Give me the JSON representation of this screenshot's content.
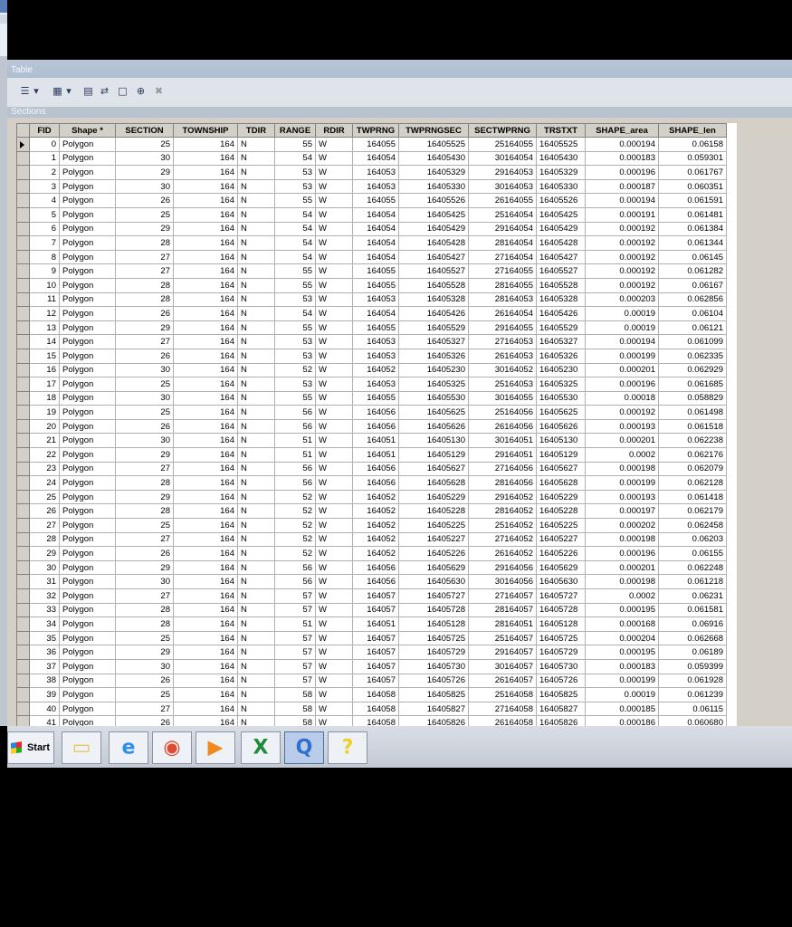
{
  "window": {
    "title": "Table",
    "tab_caption": "Sections"
  },
  "toolbar": {
    "icons": [
      "table-options-icon",
      "related-tables-icon",
      "select-by-attributes-icon",
      "switch-selection-icon",
      "clear-selection-icon",
      "zoom-to-selected-icon",
      "delete-selected-icon"
    ]
  },
  "table": {
    "columns": [
      "FID",
      "Shape *",
      "SECTION",
      "TOWNSHIP",
      "TDIR",
      "RANGE",
      "RDIR",
      "TWPRNG",
      "TWPRNGSEC",
      "SECTWPRNG",
      "TRSTXT",
      "SHAPE_area",
      "SHAPE_len"
    ],
    "rows": [
      [
        "0",
        "Polygon",
        "25",
        "164",
        "N",
        "55",
        "W",
        "164055",
        "16405525",
        "25164055",
        "16405525",
        "0.000194",
        "0.06158"
      ],
      [
        "1",
        "Polygon",
        "30",
        "164",
        "N",
        "54",
        "W",
        "164054",
        "16405430",
        "30164054",
        "16405430",
        "0.000183",
        "0.059301"
      ],
      [
        "2",
        "Polygon",
        "29",
        "164",
        "N",
        "53",
        "W",
        "164053",
        "16405329",
        "29164053",
        "16405329",
        "0.000196",
        "0.061767"
      ],
      [
        "3",
        "Polygon",
        "30",
        "164",
        "N",
        "53",
        "W",
        "164053",
        "16405330",
        "30164053",
        "16405330",
        "0.000187",
        "0.060351"
      ],
      [
        "4",
        "Polygon",
        "26",
        "164",
        "N",
        "55",
        "W",
        "164055",
        "16405526",
        "26164055",
        "16405526",
        "0.000194",
        "0.061591"
      ],
      [
        "5",
        "Polygon",
        "25",
        "164",
        "N",
        "54",
        "W",
        "164054",
        "16405425",
        "25164054",
        "16405425",
        "0.000191",
        "0.061481"
      ],
      [
        "6",
        "Polygon",
        "29",
        "164",
        "N",
        "54",
        "W",
        "164054",
        "16405429",
        "29164054",
        "16405429",
        "0.000192",
        "0.061384"
      ],
      [
        "7",
        "Polygon",
        "28",
        "164",
        "N",
        "54",
        "W",
        "164054",
        "16405428",
        "28164054",
        "16405428",
        "0.000192",
        "0.061344"
      ],
      [
        "8",
        "Polygon",
        "27",
        "164",
        "N",
        "54",
        "W",
        "164054",
        "16405427",
        "27164054",
        "16405427",
        "0.000192",
        "0.06145"
      ],
      [
        "9",
        "Polygon",
        "27",
        "164",
        "N",
        "55",
        "W",
        "164055",
        "16405527",
        "27164055",
        "16405527",
        "0.000192",
        "0.061282"
      ],
      [
        "10",
        "Polygon",
        "28",
        "164",
        "N",
        "55",
        "W",
        "164055",
        "16405528",
        "28164055",
        "16405528",
        "0.000192",
        "0.06167"
      ],
      [
        "11",
        "Polygon",
        "28",
        "164",
        "N",
        "53",
        "W",
        "164053",
        "16405328",
        "28164053",
        "16405328",
        "0.000203",
        "0.062856"
      ],
      [
        "12",
        "Polygon",
        "26",
        "164",
        "N",
        "54",
        "W",
        "164054",
        "16405426",
        "26164054",
        "16405426",
        "0.00019",
        "0.06104"
      ],
      [
        "13",
        "Polygon",
        "29",
        "164",
        "N",
        "55",
        "W",
        "164055",
        "16405529",
        "29164055",
        "16405529",
        "0.00019",
        "0.06121"
      ],
      [
        "14",
        "Polygon",
        "27",
        "164",
        "N",
        "53",
        "W",
        "164053",
        "16405327",
        "27164053",
        "16405327",
        "0.000194",
        "0.061099"
      ],
      [
        "15",
        "Polygon",
        "26",
        "164",
        "N",
        "53",
        "W",
        "164053",
        "16405326",
        "26164053",
        "16405326",
        "0.000199",
        "0.062335"
      ],
      [
        "16",
        "Polygon",
        "30",
        "164",
        "N",
        "52",
        "W",
        "164052",
        "16405230",
        "30164052",
        "16405230",
        "0.000201",
        "0.062929"
      ],
      [
        "17",
        "Polygon",
        "25",
        "164",
        "N",
        "53",
        "W",
        "164053",
        "16405325",
        "25164053",
        "16405325",
        "0.000196",
        "0.061685"
      ],
      [
        "18",
        "Polygon",
        "30",
        "164",
        "N",
        "55",
        "W",
        "164055",
        "16405530",
        "30164055",
        "16405530",
        "0.00018",
        "0.058829"
      ],
      [
        "19",
        "Polygon",
        "25",
        "164",
        "N",
        "56",
        "W",
        "164056",
        "16405625",
        "25164056",
        "16405625",
        "0.000192",
        "0.061498"
      ],
      [
        "20",
        "Polygon",
        "26",
        "164",
        "N",
        "56",
        "W",
        "164056",
        "16405626",
        "26164056",
        "16405626",
        "0.000193",
        "0.061518"
      ],
      [
        "21",
        "Polygon",
        "30",
        "164",
        "N",
        "51",
        "W",
        "164051",
        "16405130",
        "30164051",
        "16405130",
        "0.000201",
        "0.062238"
      ],
      [
        "22",
        "Polygon",
        "29",
        "164",
        "N",
        "51",
        "W",
        "164051",
        "16405129",
        "29164051",
        "16405129",
        "0.0002",
        "0.062176"
      ],
      [
        "23",
        "Polygon",
        "27",
        "164",
        "N",
        "56",
        "W",
        "164056",
        "16405627",
        "27164056",
        "16405627",
        "0.000198",
        "0.062079"
      ],
      [
        "24",
        "Polygon",
        "28",
        "164",
        "N",
        "56",
        "W",
        "164056",
        "16405628",
        "28164056",
        "16405628",
        "0.000199",
        "0.062128"
      ],
      [
        "25",
        "Polygon",
        "29",
        "164",
        "N",
        "52",
        "W",
        "164052",
        "16405229",
        "29164052",
        "16405229",
        "0.000193",
        "0.061418"
      ],
      [
        "26",
        "Polygon",
        "28",
        "164",
        "N",
        "52",
        "W",
        "164052",
        "16405228",
        "28164052",
        "16405228",
        "0.000197",
        "0.062179"
      ],
      [
        "27",
        "Polygon",
        "25",
        "164",
        "N",
        "52",
        "W",
        "164052",
        "16405225",
        "25164052",
        "16405225",
        "0.000202",
        "0.062458"
      ],
      [
        "28",
        "Polygon",
        "27",
        "164",
        "N",
        "52",
        "W",
        "164052",
        "16405227",
        "27164052",
        "16405227",
        "0.000198",
        "0.06203"
      ],
      [
        "29",
        "Polygon",
        "26",
        "164",
        "N",
        "52",
        "W",
        "164052",
        "16405226",
        "26164052",
        "16405226",
        "0.000196",
        "0.06155"
      ],
      [
        "30",
        "Polygon",
        "29",
        "164",
        "N",
        "56",
        "W",
        "164056",
        "16405629",
        "29164056",
        "16405629",
        "0.000201",
        "0.062248"
      ],
      [
        "31",
        "Polygon",
        "30",
        "164",
        "N",
        "56",
        "W",
        "164056",
        "16405630",
        "30164056",
        "16405630",
        "0.000198",
        "0.061218"
      ],
      [
        "32",
        "Polygon",
        "27",
        "164",
        "N",
        "57",
        "W",
        "164057",
        "16405727",
        "27164057",
        "16405727",
        "0.0002",
        "0.06231"
      ],
      [
        "33",
        "Polygon",
        "28",
        "164",
        "N",
        "57",
        "W",
        "164057",
        "16405728",
        "28164057",
        "16405728",
        "0.000195",
        "0.061581"
      ],
      [
        "34",
        "Polygon",
        "28",
        "164",
        "N",
        "51",
        "W",
        "164051",
        "16405128",
        "28164051",
        "16405128",
        "0.000168",
        "0.06916"
      ],
      [
        "35",
        "Polygon",
        "25",
        "164",
        "N",
        "57",
        "W",
        "164057",
        "16405725",
        "25164057",
        "16405725",
        "0.000204",
        "0.062668"
      ],
      [
        "36",
        "Polygon",
        "29",
        "164",
        "N",
        "57",
        "W",
        "164057",
        "16405729",
        "29164057",
        "16405729",
        "0.000195",
        "0.06189"
      ],
      [
        "37",
        "Polygon",
        "30",
        "164",
        "N",
        "57",
        "W",
        "164057",
        "16405730",
        "30164057",
        "16405730",
        "0.000183",
        "0.059399"
      ],
      [
        "38",
        "Polygon",
        "26",
        "164",
        "N",
        "57",
        "W",
        "164057",
        "16405726",
        "26164057",
        "16405726",
        "0.000199",
        "0.061928"
      ],
      [
        "39",
        "Polygon",
        "25",
        "164",
        "N",
        "58",
        "W",
        "164058",
        "16405825",
        "25164058",
        "16405825",
        "0.00019",
        "0.061239"
      ],
      [
        "40",
        "Polygon",
        "27",
        "164",
        "N",
        "58",
        "W",
        "164058",
        "16405827",
        "27164058",
        "16405827",
        "0.000185",
        "0.06115"
      ],
      [
        "41",
        "Polygon",
        "26",
        "164",
        "N",
        "58",
        "W",
        "164058",
        "16405826",
        "26164058",
        "16405826",
        "0.000186",
        "0.060680"
      ]
    ]
  },
  "taskbar": {
    "start_label": "Start",
    "apps": [
      {
        "name": "file-explorer-icon",
        "color": "#e8c45a"
      },
      {
        "name": "internet-explorer-icon",
        "color": "#2f8ee8"
      },
      {
        "name": "chrome-icon",
        "color": "#e04a2f"
      },
      {
        "name": "media-player-icon",
        "color": "#f08a1e"
      },
      {
        "name": "excel-icon",
        "color": "#1f8a3b"
      },
      {
        "name": "arcmap-icon",
        "color": "#2f6fd0"
      },
      {
        "name": "help-icon",
        "color": "#f0d020"
      }
    ]
  }
}
